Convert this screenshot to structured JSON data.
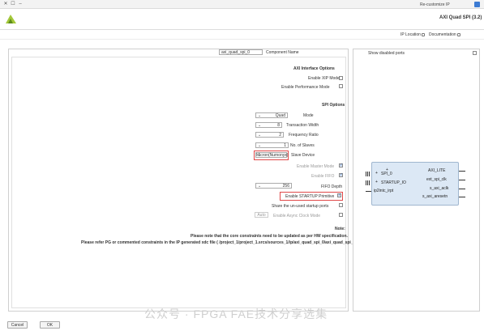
{
  "window": {
    "title": "Re-customize IP"
  },
  "header": {
    "dialog_title": "AXI Quad SPI (3.2)"
  },
  "links": {
    "documentation": "Documentation",
    "ip_location": "IP Location"
  },
  "symbol_panel": {
    "show_disabled_ports": "Show disabled ports",
    "ports_right": [
      "AXI_LITE",
      "ext_spi_clk",
      "s_axi_aclk",
      "s_axi_aresetn"
    ],
    "ports_left": [
      "SPI_0",
      "STARTUP_IO",
      "ip2intc_irpt"
    ]
  },
  "component": {
    "label": "Component Name",
    "value": "axi_quad_spi_0"
  },
  "axi_options": {
    "title": "AXI Interface Options",
    "enable_xip": "Enable XIP Mode",
    "enable_perf": "Enable Performance Mode"
  },
  "spi_options": {
    "title": "SPI Options",
    "mode_label": "Mode",
    "mode_value": "Quad",
    "transaction_width_label": "Transaction Width",
    "transaction_width_value": "8",
    "frequency_ratio_label": "Frequency Ratio",
    "frequency_ratio_value": "2",
    "no_of_slaves_label": "No. of Slaves",
    "no_of_slaves_value": "1",
    "slave_device_label": "Slave Device",
    "slave_device_value": "Micron(Numonyx)",
    "enable_master_mode": "Enable Master Mode",
    "enable_fifo": "Enable FIFO",
    "fifo_depth_label": "FIFO Depth",
    "fifo_depth_value": "256",
    "enable_startup": "Enable STARTUP Primitive",
    "share_startup": "Share the un-used startup ports",
    "enable_async": "Enable Async Clock Mode",
    "async_value": "Auto"
  },
  "note": {
    "title": "Note:",
    "line1": "Please note that the core constraints need to be updated as per HW specification.",
    "line2": "Please refer PG or commented constraints in the IP generated xdc file ( /project_1/project_1.srcs/sources_1/ip/axi_quad_spi_0/axi_quad_spi_0.xdc )."
  },
  "buttons": {
    "ok": "OK",
    "cancel": "Cancel"
  },
  "watermark": "公众号 · FPGA FAE技术分享选集"
}
